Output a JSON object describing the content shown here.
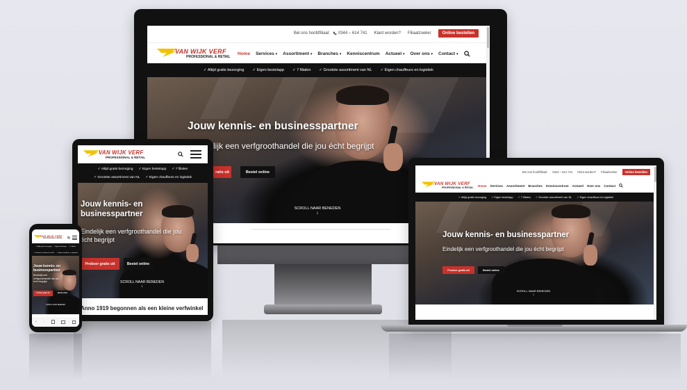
{
  "site": {
    "topbar": {
      "phone_prefix": "Bel ons hoofdfiliaal:",
      "phone_number": "0344 – 614 741",
      "klant_worden": "Klant worden?",
      "filiaalzoeker": "Filiaalzoeker",
      "online_bestellen": "Online bestellen"
    },
    "logo": {
      "line1": "VAN WIJK VERF",
      "line2": "PROFESSIONAL & RETAIL"
    },
    "nav": [
      {
        "label": "Home",
        "active": true
      },
      {
        "label": "Services",
        "dropdown": true
      },
      {
        "label": "Assortiment",
        "dropdown": true
      },
      {
        "label": "Branches",
        "dropdown": true
      },
      {
        "label": "Kenniscentrum",
        "dropdown": false
      },
      {
        "label": "Actueel",
        "dropdown": true
      },
      {
        "label": "Over ons",
        "dropdown": true
      },
      {
        "label": "Contact",
        "dropdown": true
      }
    ],
    "usps": [
      "Altijd gratis bezorging",
      "Eigen bestelapp",
      "7 filialen",
      "Grootste assortiment van NL",
      "Eigen chauffeurs en logistiek"
    ],
    "hero": {
      "title": "Jouw kennis- en businesspartner",
      "subtitle": "Eindelijk een verfgroothandel die jou écht begrijpt",
      "desktop_subtitle_visible": "lijk een verfgroothandel die jou écht begrijpt",
      "tablet_title_line1": "Jouw kennis- en",
      "tablet_title_line2": "businesspartner",
      "tablet_subtitle_line1": "Eindelijk een verfgroothandel die jou",
      "tablet_subtitle_line2": "écht begrijpt",
      "cta_primary": "Probeer gratis uit",
      "cta_primary_visible": "ratis uit",
      "cta_secondary": "Bestel online",
      "scroll_label": "SCROLL NAAR BENEDEN",
      "scroll_arrow": "↓"
    },
    "tablet_below_text": "Anno 1919 begonnen als een kleine verfwinkel",
    "phone": {
      "hero_title": "Jouw kennis- en businesspartner",
      "hero_subtitle": "Eindelijk een verfgroothandel die jou écht begrijpt",
      "scroll_label": "SCROLL NAAR BENEDEN"
    },
    "icons": {
      "search": "search-icon",
      "menu": "hamburger-menu-icon",
      "phone": "phone-icon",
      "check": "✓",
      "chevron": "⌄"
    },
    "colors": {
      "brand_red": "#c8322b",
      "logo_yellow": "#f2c200",
      "usp_bar": "#111111"
    }
  }
}
